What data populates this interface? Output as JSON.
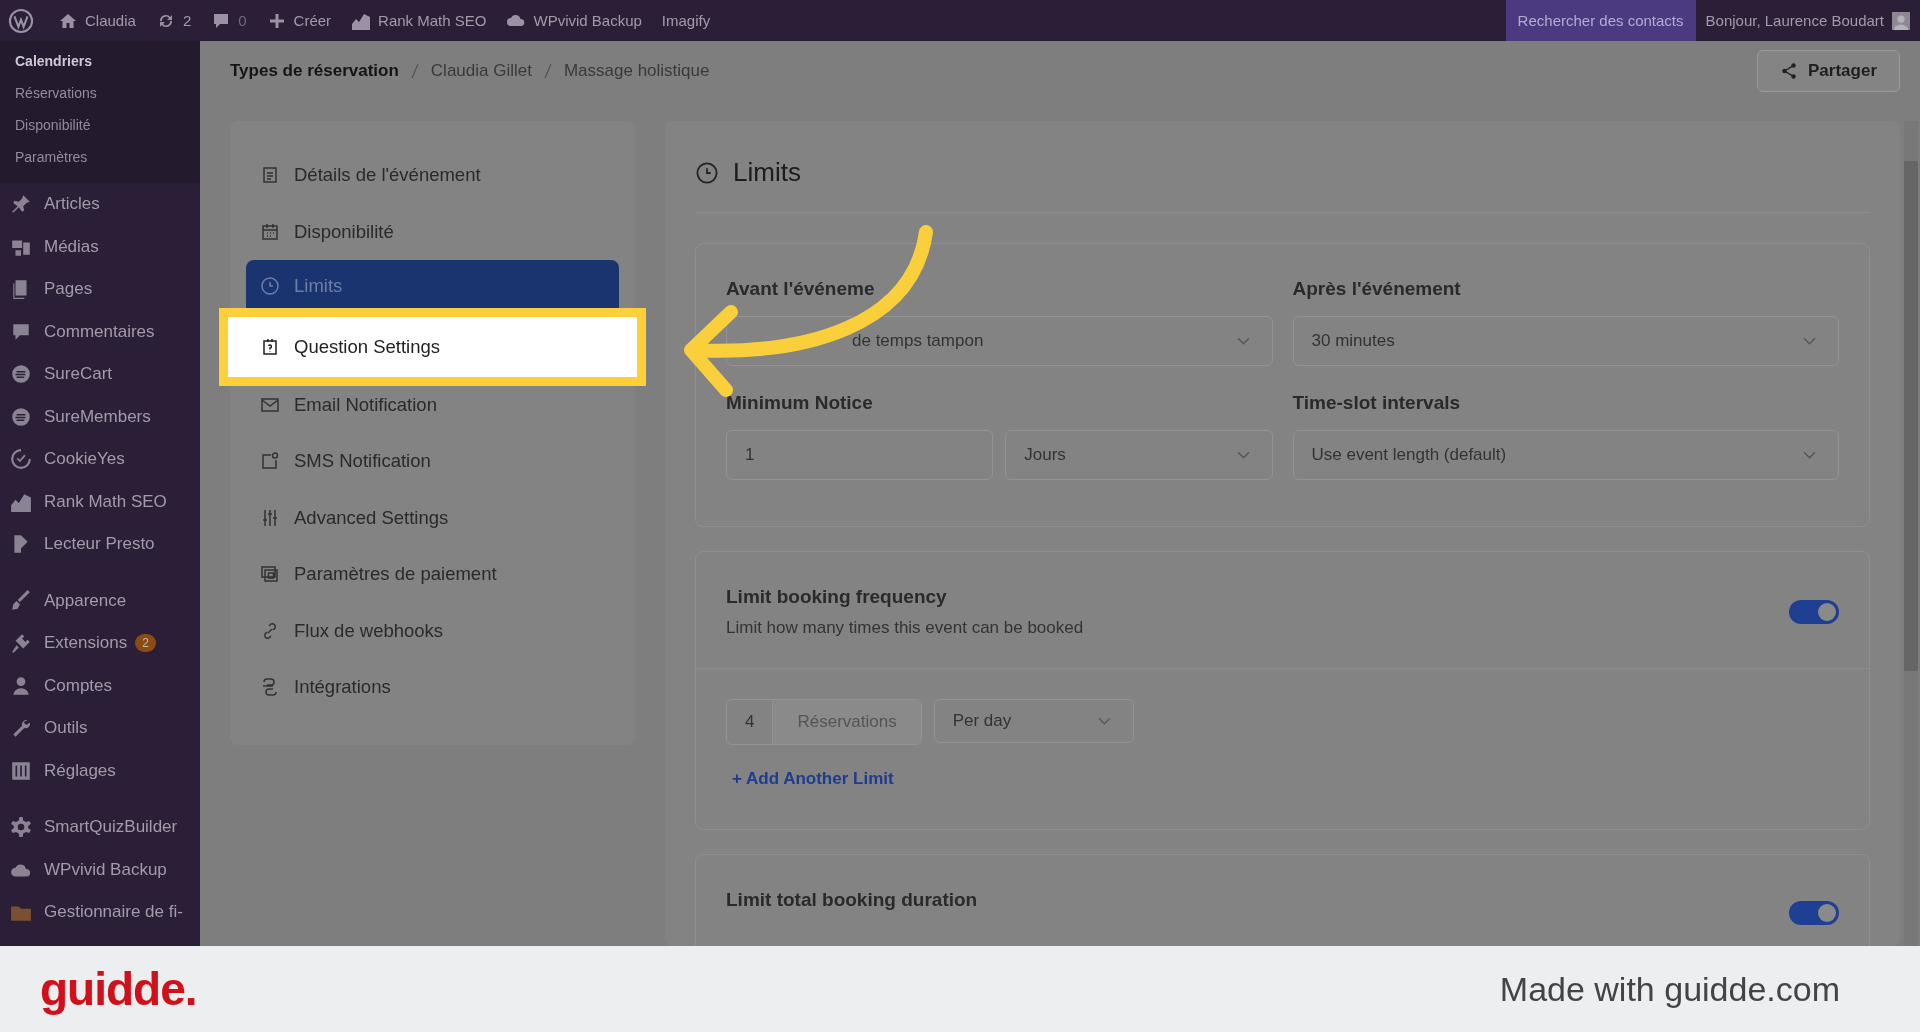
{
  "top_bar": {
    "site": "Claudia",
    "updates": "2",
    "comments": "0",
    "new": "Créer",
    "items": [
      "Rank Math SEO",
      "WPvivid Backup",
      "Imagify"
    ],
    "search_contacts": "Rechercher des contacts",
    "greeting": "Bonjour, Laurence Boudart"
  },
  "sidebar": {
    "submenu": [
      {
        "label": "Calendriers",
        "selected": true
      },
      {
        "label": "Réservations",
        "selected": false
      },
      {
        "label": "Disponibilité",
        "selected": false
      },
      {
        "label": "Paramètres",
        "selected": false
      }
    ],
    "groups": [
      [
        {
          "label": "Articles"
        },
        {
          "label": "Médias"
        },
        {
          "label": "Pages"
        },
        {
          "label": "Commentaires"
        },
        {
          "label": "SureCart"
        },
        {
          "label": "SureMembers"
        },
        {
          "label": "CookieYes"
        },
        {
          "label": "Rank Math SEO"
        },
        {
          "label": "Lecteur Presto"
        }
      ],
      [
        {
          "label": "Apparence"
        },
        {
          "label": "Extensions",
          "badge": "2"
        },
        {
          "label": "Comptes"
        },
        {
          "label": "Outils"
        },
        {
          "label": "Réglages"
        }
      ],
      [
        {
          "label": "SmartQuizBuilder"
        },
        {
          "label": "WPvivid Backup"
        },
        {
          "label": "Gestionnaire de fi-"
        }
      ]
    ]
  },
  "breadcrumb": [
    "Types de réservation",
    "Claudia Gillet",
    "Massage holistique"
  ],
  "share_button": "Partager",
  "nav": [
    {
      "label": "Détails de l'événement",
      "selected": false,
      "highlighted": false
    },
    {
      "label": "Disponibilité",
      "selected": false,
      "highlighted": false
    },
    {
      "label": "Limits",
      "selected": true,
      "highlighted": false
    },
    {
      "label": "Question Settings",
      "selected": false,
      "highlighted": true
    },
    {
      "label": "Email Notification",
      "selected": false,
      "highlighted": false
    },
    {
      "label": "SMS Notification",
      "selected": false,
      "highlighted": false
    },
    {
      "label": "Advanced Settings",
      "selected": false,
      "highlighted": false
    },
    {
      "label": "Paramètres de paiement",
      "selected": false,
      "highlighted": false
    },
    {
      "label": "Flux de webhooks",
      "selected": false,
      "highlighted": false
    },
    {
      "label": "Intégrations",
      "selected": false,
      "highlighted": false
    }
  ],
  "limits": {
    "title": "Limits",
    "fields": [
      {
        "label": "Avant l'événeme",
        "value": "de temps tampon",
        "kind": "select"
      },
      {
        "label": "Après l'événement",
        "value": "30 minutes",
        "kind": "select"
      },
      {
        "label": "Minimum Notice",
        "value": "1",
        "unit": "Jours",
        "kind": "number_unit"
      },
      {
        "label": "Time-slot intervals",
        "value": "Use event length (default)",
        "kind": "select"
      }
    ],
    "frequency": {
      "title": "Limit booking frequency",
      "description": "Limit how many times this event can be booked",
      "on": true,
      "count": "4",
      "unit": "Réservations",
      "period": "Per day",
      "add_link": "+ Add Another Limit"
    },
    "duration": {
      "title": "Limit total booking duration",
      "on": true
    }
  },
  "footer": {
    "logo": "guidde.",
    "tagline": "Made with guidde.com"
  }
}
